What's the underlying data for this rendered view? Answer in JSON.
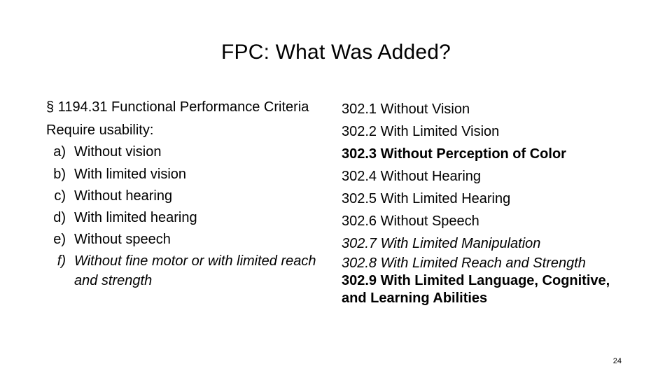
{
  "slide": {
    "title": "FPC:  What Was Added?",
    "page_number": "24",
    "left_column": {
      "heading": "§ 1194.31 Functional Performance Criteria",
      "subheading": "Require usability:",
      "items": [
        {
          "marker": "a)",
          "text": "Without vision",
          "style": "normal"
        },
        {
          "marker": "b)",
          "text": "With limited vision",
          "style": "normal"
        },
        {
          "marker": "c)",
          "text": "Without hearing",
          "style": "normal"
        },
        {
          "marker": "d)",
          "text": "With limited hearing",
          "style": "normal"
        },
        {
          "marker": "e)",
          "text": "Without speech",
          "style": "normal"
        },
        {
          "marker": "f)",
          "text": "Without fine motor or with limited reach and strength",
          "style": "italic"
        }
      ]
    },
    "right_column": {
      "items": [
        {
          "text": "302.1 Without Vision",
          "style": "normal"
        },
        {
          "text": "302.2 With Limited Vision",
          "style": "normal"
        },
        {
          "text": "302.3 Without Perception of Color",
          "style": "bold"
        },
        {
          "text": "302.4 Without Hearing",
          "style": "normal"
        },
        {
          "text": "302.5 With Limited Hearing",
          "style": "normal"
        },
        {
          "text": "302.6 Without Speech",
          "style": "normal"
        },
        {
          "text": "302.7 With Limited Manipulation",
          "style": "italic"
        },
        {
          "text": "302.8 With Limited Reach and Strength",
          "style": "italic"
        },
        {
          "text": "302.9 With Limited Language, Cognitive, and Learning Abilities",
          "style": "bold"
        }
      ]
    }
  }
}
